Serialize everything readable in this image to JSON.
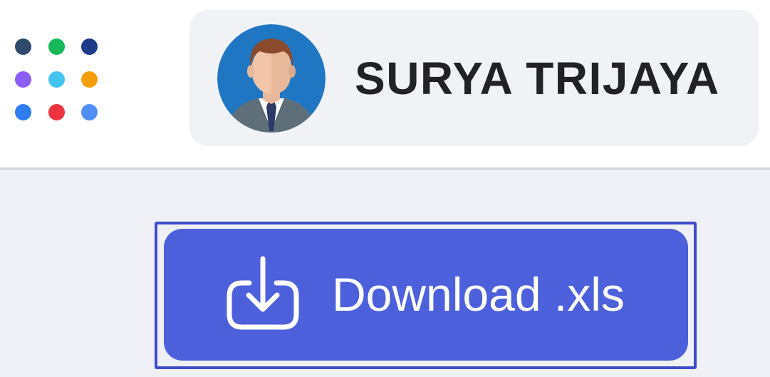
{
  "apps_menu": {
    "icon": "apps-grid-icon",
    "dot_colors": [
      "#2f4a6b",
      "#16b85a",
      "#1e3a8a",
      "#8b5cf6",
      "#42c3f0",
      "#f59e0b",
      "#2d7cf0",
      "#ef3340",
      "#4f8ef6"
    ]
  },
  "user": {
    "name": "SURYA TRIJAYA",
    "avatar_icon": "user-avatar-icon"
  },
  "download": {
    "label": "Download .xls",
    "icon": "download-icon",
    "accent_color": "#4d60db"
  }
}
